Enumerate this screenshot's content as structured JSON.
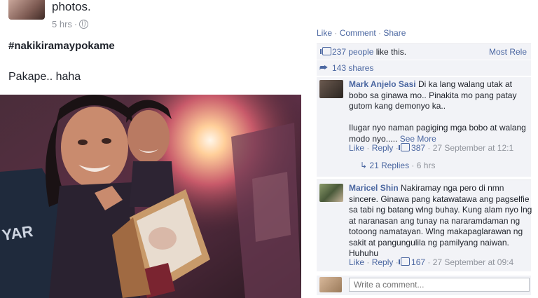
{
  "post": {
    "header_text": "photos.",
    "time": "5 hrs",
    "hashtag": "#nakikiramaypokame",
    "text": "Pakape.. haha"
  },
  "actions": {
    "like": "Like",
    "comment": "Comment",
    "share": "Share",
    "sep": " · "
  },
  "likes": {
    "count": "237 people",
    "suffix": " like this.",
    "sort": "Most Rele"
  },
  "shares": {
    "label": "143 shares"
  },
  "comments": [
    {
      "name": "Mark Anjelo Sasi",
      "text": "Di ka lang walang utak at bobo sa ginawa mo.. Pinakita mo pang patay gutom kang demonyo ka..\n\nIlugar nyo naman pagiging mga bobo at walang modo nyo.....",
      "see_more": "See More",
      "like": "Like",
      "reply": "Reply",
      "likes": "387",
      "date": "27 September at 12:1",
      "replies": "21 Replies",
      "replies_time": "6 hrs"
    },
    {
      "name": "Maricel Shin",
      "text": "Nakiramay nga pero di nmn sincere. Ginawa pang katawatawa ang pagselfie sa tabi ng batang wlng buhay. Kung alam nyo lng at naranasan ang tunay na nararamdaman ng totoong namatayan. Wlng makapaglarawan ng sakit at pangungulila ng pamilyang naiwan. Huhuhu",
      "like": "Like",
      "reply": "Reply",
      "likes": "167",
      "date": "27 September at 09:4"
    }
  ],
  "composer": {
    "placeholder": "Write a comment..."
  }
}
